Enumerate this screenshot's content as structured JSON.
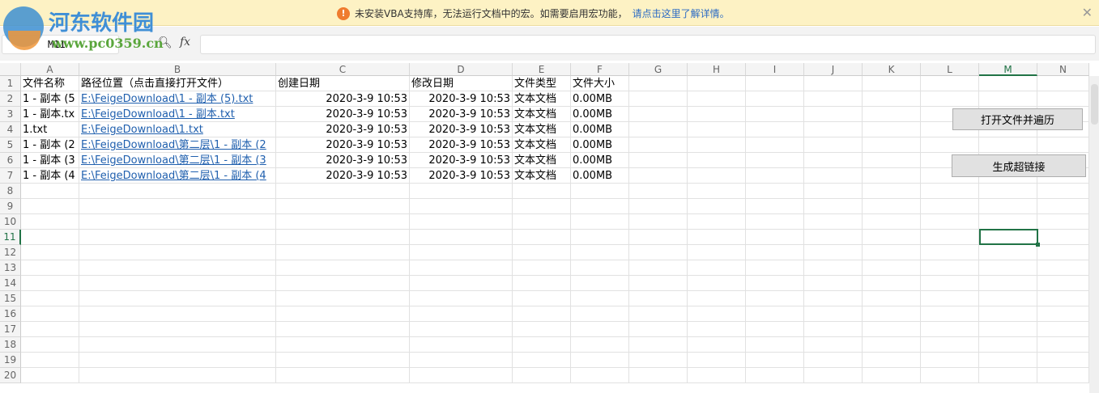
{
  "notice": {
    "message": "未安装VBA支持库，无法运行文档中的宏。如需要启用宏功能，",
    "link": "请点击这里了解详情。",
    "icon": "warning-icon"
  },
  "watermark": {
    "title": "河东软件园",
    "url": "www.pc0359.cn"
  },
  "formula_bar": {
    "name_box": "M11",
    "fx": "fx",
    "value": ""
  },
  "columns": [
    "A",
    "B",
    "C",
    "D",
    "E",
    "F",
    "G",
    "H",
    "I",
    "J",
    "K",
    "L",
    "M",
    "N"
  ],
  "rows": [
    [
      "文件名称",
      "路径位置（点击直接打开文件）",
      "创建日期",
      "修改日期",
      "文件类型",
      "文件大小"
    ],
    [
      "1 - 副本 (5",
      "E:\\FeigeDownload\\1 - 副本 (5).txt",
      "2020-3-9 10:53",
      "2020-3-9 10:53",
      "文本文档",
      "0.00MB"
    ],
    [
      "1 - 副本.tx",
      "E:\\FeigeDownload\\1 - 副本.txt",
      "2020-3-9 10:53",
      "2020-3-9 10:53",
      "文本文档",
      "0.00MB"
    ],
    [
      "1.txt",
      "E:\\FeigeDownload\\1.txt",
      "2020-3-9 10:53",
      "2020-3-9 10:53",
      "文本文档",
      "0.00MB"
    ],
    [
      "1 - 副本 (2",
      "E:\\FeigeDownload\\第二层\\1 - 副本 (2",
      "2020-3-9 10:53",
      "2020-3-9 10:53",
      "文本文档",
      "0.00MB"
    ],
    [
      "1 - 副本 (3",
      "E:\\FeigeDownload\\第二层\\1 - 副本 (3",
      "2020-3-9 10:53",
      "2020-3-9 10:53",
      "文本文档",
      "0.00MB"
    ],
    [
      "1 - 副本 (4",
      "E:\\FeigeDownload\\第二层\\1 - 副本 (4",
      "2020-3-9 10:53",
      "2020-3-9 10:53",
      "文本文档",
      "0.00MB"
    ]
  ],
  "row_count": 20,
  "buttons": {
    "open": "打开文件并遍历",
    "hyperlink": "生成超链接"
  },
  "selected_cell": "M11"
}
